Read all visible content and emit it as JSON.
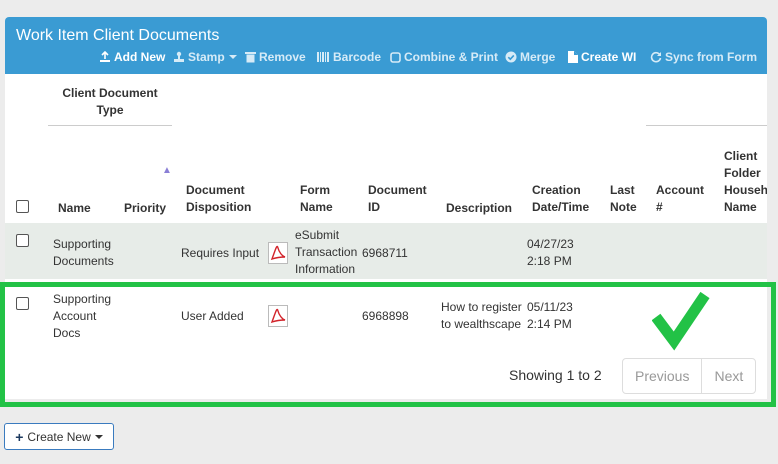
{
  "panel": {
    "title": "Work Item Client Documents"
  },
  "toolbar": {
    "add_new": "Add New",
    "stamp": "Stamp",
    "remove": "Remove",
    "barcode": "Barcode",
    "combine_print": "Combine & Print",
    "merge": "Merge",
    "create_wi": "Create WI",
    "sync_from_form": "Sync from Form"
  },
  "table": {
    "group_header": "Client Document Type",
    "sort_indicator": "▲",
    "columns": {
      "name": "Name",
      "priority": "Priority",
      "document_disposition": "Document Disposition",
      "form_name": "Form Name",
      "document_id": "Document ID",
      "description": "Description",
      "creation_datetime": "Creation Date/Time",
      "last_note": "Last Note",
      "account": "Account #",
      "client_folder": "Client Folder Househ Name"
    },
    "rows": [
      {
        "name": "Supporting Documents",
        "priority": "",
        "disposition": "Requires Input",
        "form_name": "eSubmit Transaction Information",
        "document_id": "6968711",
        "description": "",
        "creation": "04/27/23 2:18 PM",
        "last_note": "",
        "account": "",
        "client_folder": ""
      },
      {
        "name": "Supporting Account Docs",
        "priority": "",
        "disposition": "User Added",
        "form_name": "",
        "document_id": "6968898",
        "description": "How to register to wealthscape",
        "creation": "05/11/23 2:14 PM",
        "last_note": "",
        "account": "",
        "client_folder": ""
      }
    ]
  },
  "pagination": {
    "showing": "Showing 1 to 2",
    "previous": "Previous",
    "next": "Next"
  },
  "create_new": {
    "label": "Create New"
  },
  "colors": {
    "header": "#3a9bd3",
    "highlight": "#22c246",
    "row_alt": "#e7ece8"
  }
}
